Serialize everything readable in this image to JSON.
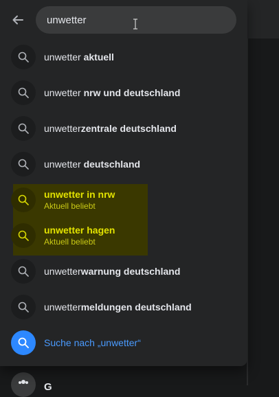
{
  "search": {
    "value": "unwetter"
  },
  "suggestions": [
    {
      "prefix": "unwetter",
      "suffix": " aktuell"
    },
    {
      "prefix": "unwetter",
      "suffix": " nrw und deutschland"
    },
    {
      "prefix": "unwetter",
      "suffix": "zentrale deutschland"
    },
    {
      "prefix": "unwetter",
      "suffix": " deutschland"
    }
  ],
  "trending": [
    {
      "title": "unwetter in nrw",
      "subtitle": "Aktuell beliebt"
    },
    {
      "title": "unwetter hagen",
      "subtitle": "Aktuell beliebt"
    }
  ],
  "suggestions_more": [
    {
      "prefix": "unwetter",
      "suffix": "warnung deutschland"
    },
    {
      "prefix": "unwetter",
      "suffix": "meldungen deutschland"
    }
  ],
  "search_for": {
    "label": "Suche nach „unwetter“"
  },
  "background": {
    "partial_text": "G"
  },
  "colors": {
    "accent": "#2d88ff",
    "highlight": "#3a3800",
    "highlight_text": "#e2e200"
  }
}
